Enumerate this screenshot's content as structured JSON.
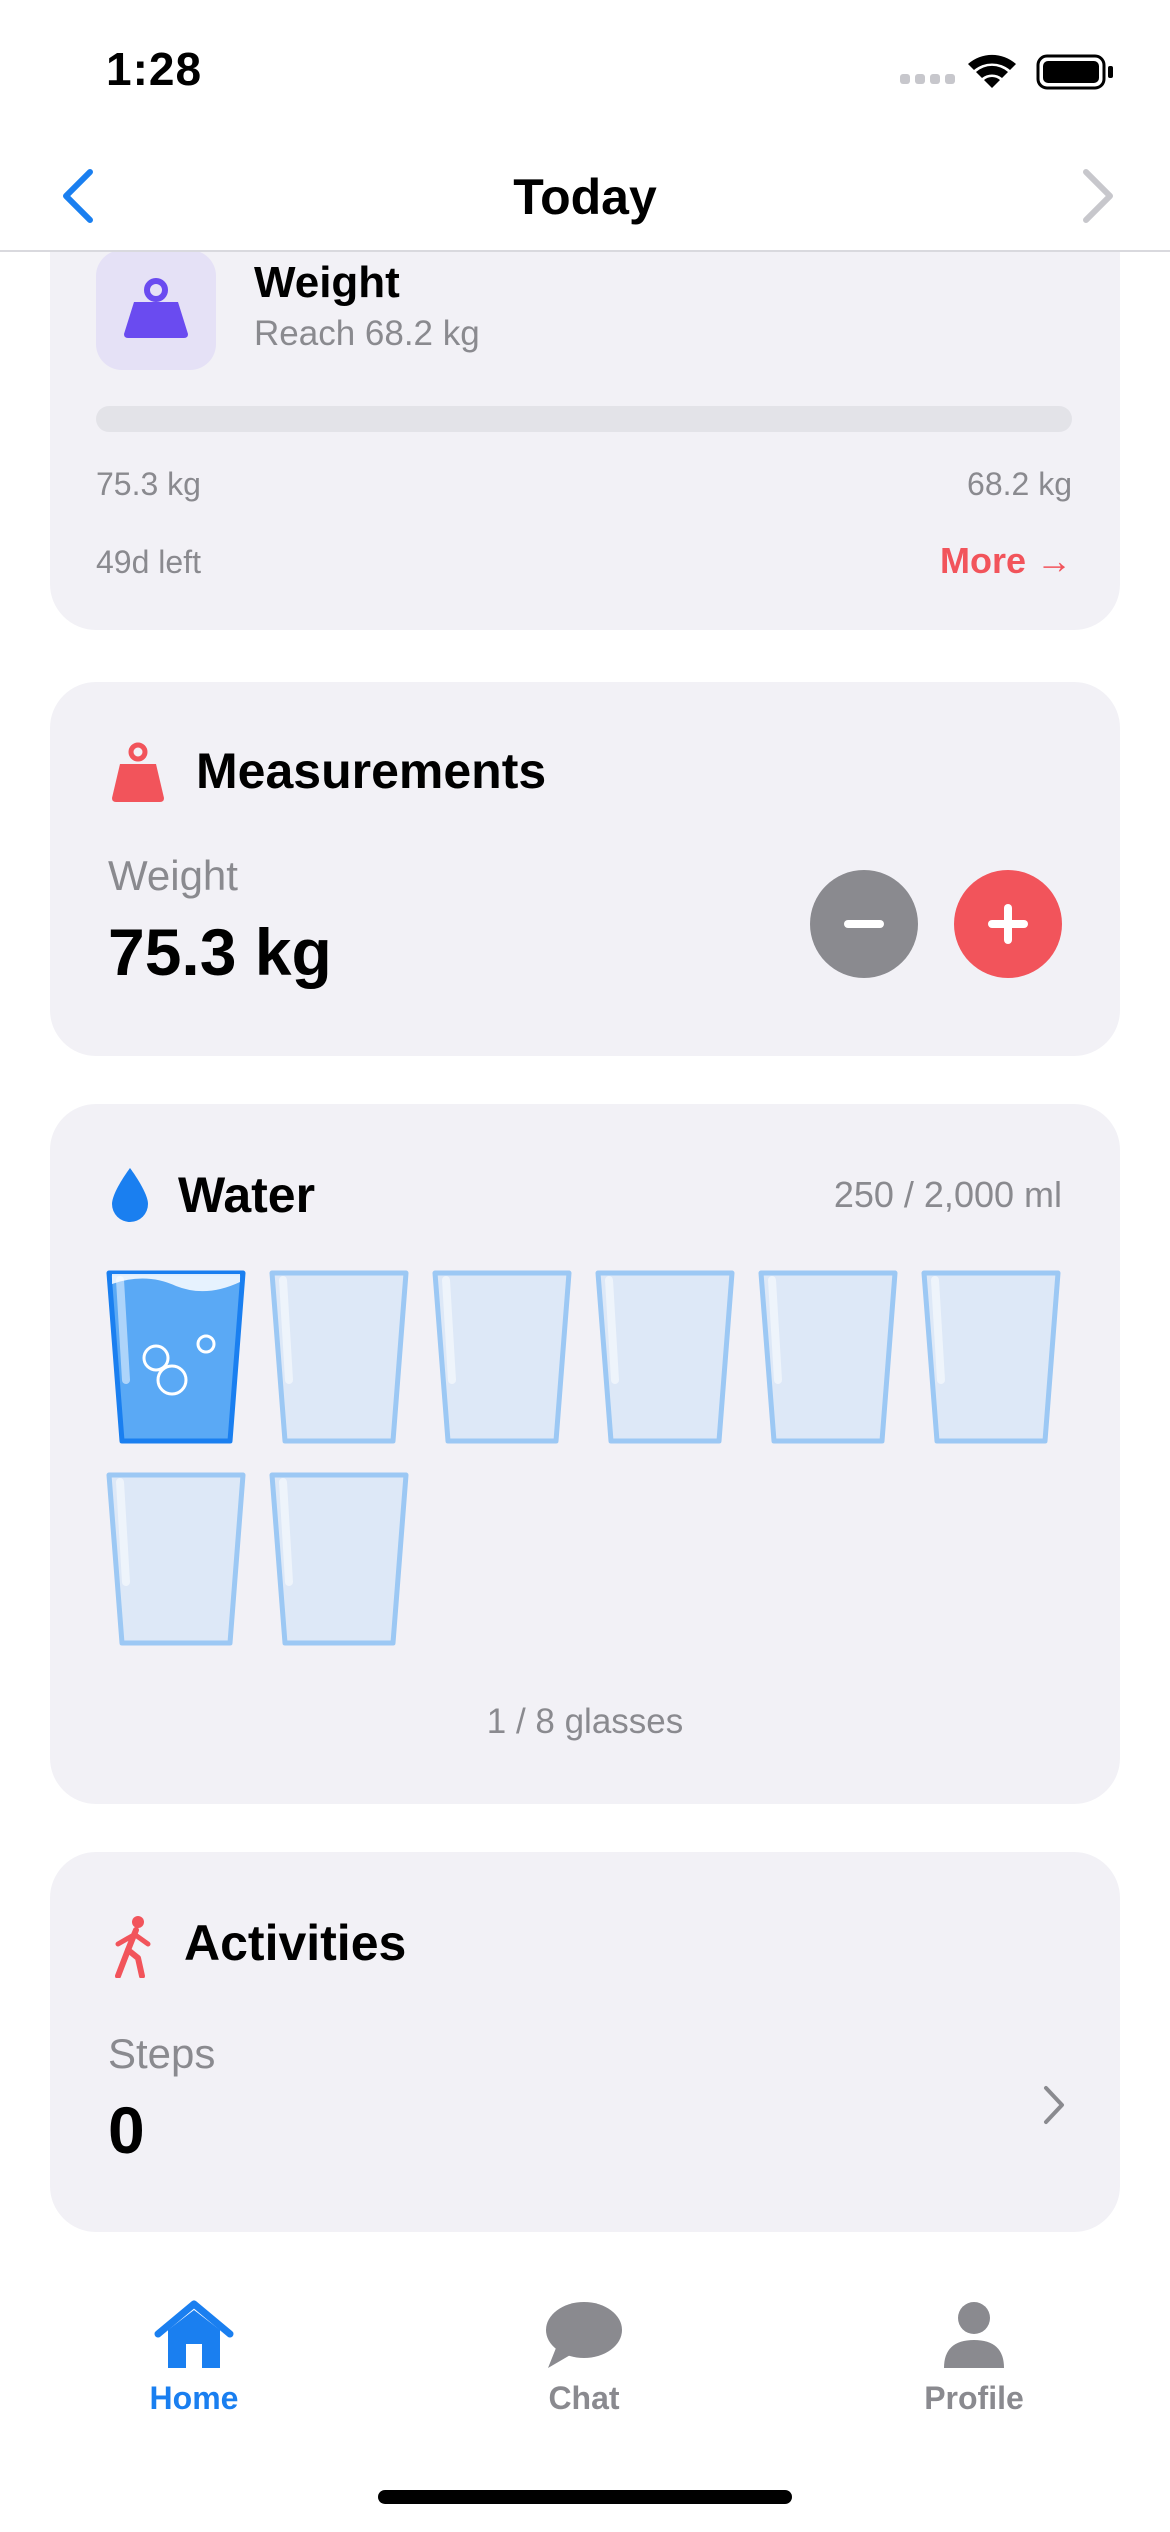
{
  "status": {
    "time": "1:28"
  },
  "nav": {
    "title": "Today"
  },
  "goal": {
    "title": "Weight",
    "subtitle": "Reach 68.2 kg",
    "start": "75.3 kg",
    "target": "68.2 kg",
    "days_left": "49d left",
    "more_label": "More →",
    "progress": 0
  },
  "measurements": {
    "title": "Measurements",
    "label": "Weight",
    "value": "75.3 kg"
  },
  "water": {
    "title": "Water",
    "amount": "250 / 2,000 ml",
    "glasses_filled": 1,
    "glasses_total": 8,
    "count_label": "1 / 8 glasses"
  },
  "activities": {
    "title": "Activities",
    "label": "Steps",
    "value": "0"
  },
  "tabs": [
    {
      "label": "Home",
      "icon": "house-icon",
      "active": true
    },
    {
      "label": "Chat",
      "icon": "chat-bubble-icon",
      "active": false
    },
    {
      "label": "Profile",
      "icon": "person-icon",
      "active": false
    }
  ],
  "colors": {
    "accent_blue": "#1a7ff0",
    "accent_red": "#f2545b",
    "accent_purple": "#6a4bf0",
    "card_bg": "#f2f1f6",
    "secondary_text": "#8a8a8f"
  }
}
